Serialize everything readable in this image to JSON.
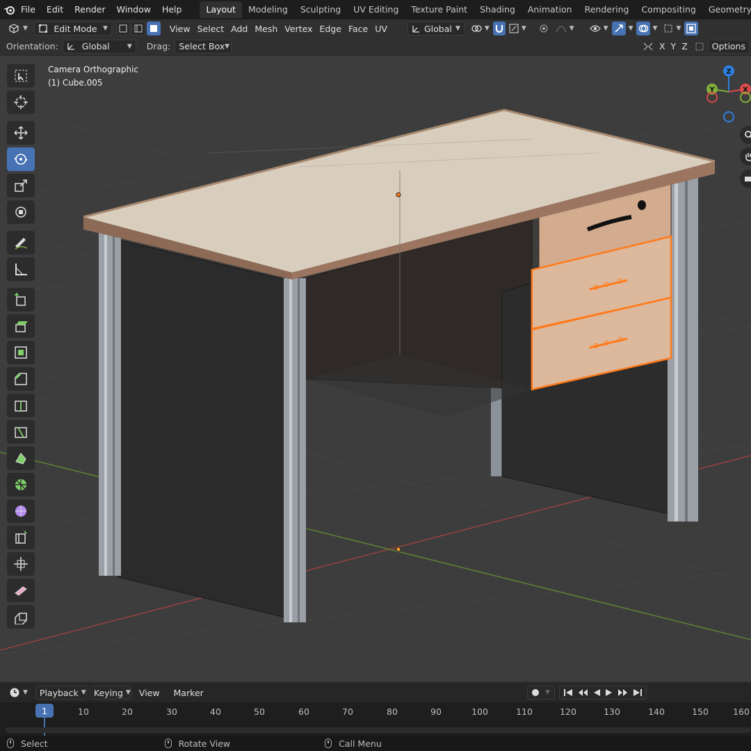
{
  "menu": {
    "items": [
      "File",
      "Edit",
      "Render",
      "Window",
      "Help"
    ],
    "workspaces": [
      "Layout",
      "Modeling",
      "Sculpting",
      "UV Editing",
      "Texture Paint",
      "Shading",
      "Animation",
      "Rendering",
      "Compositing",
      "Geometry Nodes"
    ],
    "active_workspace": "Layout"
  },
  "header": {
    "mode": "Edit Mode",
    "menus": [
      "View",
      "Select",
      "Add",
      "Mesh",
      "Vertex",
      "Edge",
      "Face",
      "UV"
    ],
    "transform_orientation": "Global"
  },
  "tool_settings": {
    "orientation_label": "Orientation:",
    "orientation_value": "Global",
    "drag_label": "Drag:",
    "drag_value": "Select Box",
    "axes": [
      "X",
      "Y",
      "Z"
    ],
    "options_label": "Options"
  },
  "viewport": {
    "view_name": "Camera Orthographic",
    "object_name": "(1) Cube.005"
  },
  "gizmo": {
    "z": "Z",
    "y": "Y",
    "x": "X"
  },
  "toolbar": {
    "tools": [
      "select-box",
      "cursor",
      "move",
      "rotate",
      "scale",
      "transform",
      "annotate",
      "measure",
      "add-cube",
      "extrude-region",
      "inset-faces",
      "bevel",
      "loop-cut",
      "knife",
      "poly-build",
      "spin",
      "smooth",
      "edge-slide",
      "shrink-fatten",
      "shear",
      "rip-region"
    ],
    "active_tool": "rotate"
  },
  "timeline": {
    "menus": [
      "Playback",
      "Keying",
      "View",
      "Marker"
    ],
    "current_frame": "1",
    "frame_labels": [
      "10",
      "20",
      "30",
      "40",
      "50",
      "60",
      "70",
      "80",
      "90",
      "100",
      "110",
      "120",
      "130",
      "140",
      "150",
      "160"
    ]
  },
  "statusbar": {
    "select": "Select",
    "rotate_view": "Rotate View",
    "call_menu": "Call Menu"
  },
  "colors": {
    "accent": "#4772b3",
    "selection": "#ff7a1a",
    "x_axis": "#d94a4a",
    "y_axis": "#7fae3a",
    "z_axis": "#2e7fe0"
  }
}
